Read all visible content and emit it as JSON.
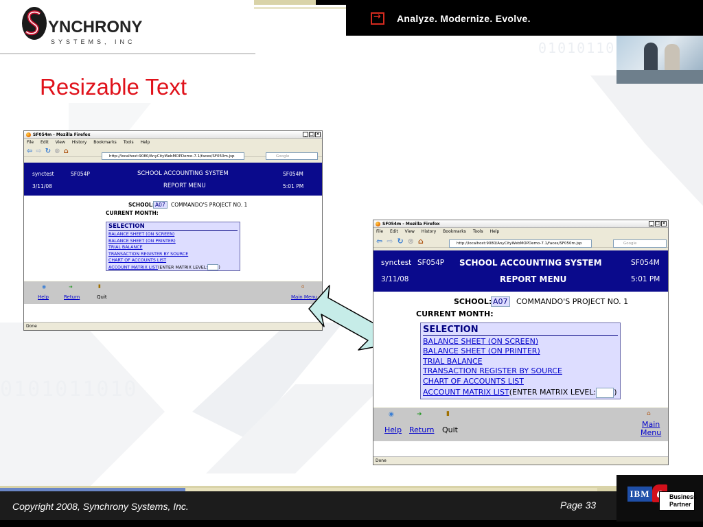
{
  "brand": {
    "logo_word": "YNCHRONY",
    "logo_sub": "SYSTEMS, INC",
    "tagline": "Analyze. Modernize. Evolve.",
    "binary": "0101011010",
    "colors": {
      "title_red": "#e0121b",
      "app_header_blue": "#0a0a8c",
      "link_blue": "#0000cc",
      "selection_bg": "#ddddff"
    }
  },
  "slide": {
    "title": "Resizable Text",
    "copyright": "Copyright 2008, Synchrony Systems, Inc.",
    "page": "Page 33",
    "partner": {
      "ibm": "IBM",
      "e": "e",
      "business": "Business",
      "partner": "Partner"
    }
  },
  "browser": {
    "title": "SF054m - Mozilla Firefox",
    "menus": [
      "File",
      "Edit",
      "View",
      "History",
      "Bookmarks",
      "Tools",
      "Help"
    ],
    "url": "http://localhost:9080/AnyCityWebMOPDemo-7.1/faces/SF050m.jsp",
    "search_placeholder": "Google",
    "status": "Done",
    "icons": [
      "back-arrow-icon",
      "forward-arrow-icon",
      "reload-icon",
      "stop-icon",
      "home-icon",
      "page-icon",
      "go-icon",
      "google-icon",
      "search-icon"
    ]
  },
  "app": {
    "user": "synctest",
    "program": "SF054P",
    "system": "SCHOOL ACCOUNTING SYSTEM",
    "screen_id": "SF054M",
    "date": "3/11/08",
    "menu_title": "REPORT MENU",
    "time": "5:01 PM",
    "school_label": "SCHOOL:",
    "school_code": "A07",
    "school_name": "COMMANDO'S PROJECT NO. 1",
    "current_month_label": "CURRENT MONTH:",
    "selection_title": "SELECTION",
    "options": [
      "BALANCE SHEET (ON SCREEN)",
      "BALANCE SHEET (ON PRINTER)",
      "TRIAL BALANCE",
      "TRANSACTION REGISTER BY SOURCE",
      "CHART OF ACCOUNTS LIST"
    ],
    "matrix_link": "ACCOUNT MATRIX LIST",
    "matrix_label": "(ENTER MATRIX LEVEL:",
    "matrix_close": ")",
    "footer": {
      "help": "Help",
      "return": "Return",
      "quit": "Quit",
      "main_menu": "Main Menu",
      "main_menu_line1": "Main",
      "main_menu_line2": "Menu"
    }
  }
}
